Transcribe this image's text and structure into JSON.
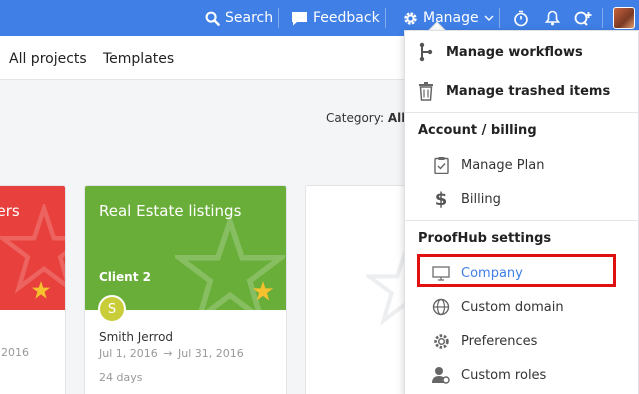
{
  "topbar": {
    "search_label": "Search",
    "feedback_label": "Feedback",
    "manage_label": "Manage",
    "icons": [
      "search-icon",
      "feedback-icon",
      "gear-icon",
      "chevron-down-icon",
      "timer-icon",
      "bell-icon",
      "quick-add-icon"
    ]
  },
  "nav": {
    "all_projects": "All projects",
    "templates": "Templates"
  },
  "filter": {
    "category_label": "Category:",
    "category_value": "All"
  },
  "cards": [
    {
      "title": "pers",
      "date_fragment": "2016",
      "color": "#e8413d"
    },
    {
      "title": "Real Estate listings",
      "client": "Client 2",
      "badge": "S",
      "owner": "Smith Jerrod",
      "start": "Jul 1, 2016",
      "end": "Jul 31, 2016",
      "days": "24 days",
      "color": "#6aae3a"
    }
  ],
  "menu": {
    "manage_workflows": "Manage workflows",
    "manage_trashed": "Manage trashed items",
    "account_header": "Account / billing",
    "manage_plan": "Manage Plan",
    "billing": "Billing",
    "settings_header": "ProofHub settings",
    "company": "Company",
    "custom_domain": "Custom domain",
    "preferences": "Preferences",
    "custom_roles": "Custom roles"
  },
  "colors": {
    "topbar": "#3f7fe6",
    "star": "#f5c12e",
    "highlight": "#e01010",
    "active_link": "#3f7fe6"
  }
}
